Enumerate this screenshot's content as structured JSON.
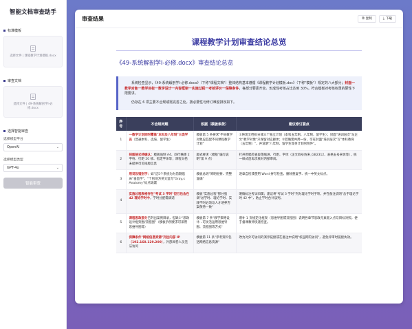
{
  "sidebar": {
    "app_title": "智能文档审查助手",
    "template_section": {
      "label": "标准模板",
      "file_name": "选择文件 | 课程教学计划模板.docx"
    },
    "review_doc_section": {
      "label": "审查文档",
      "file_name": "选择文件 | 49-系统解剖学I-必修.docx"
    },
    "smart_review_section": {
      "label": "选择智能审查",
      "platform_label": "选择模型平台",
      "platform_value": "OpenAI",
      "model_label": "选择模型类型",
      "model_value": "GPT-4o",
      "button_label": "智能审查"
    }
  },
  "panel": {
    "title": "审查结果",
    "copy_label": "复制",
    "download_label": "下载",
    "doc_title": "课程教学计划审查结论总览",
    "doc_subtitle": "《49-系统解剖学I-必修.docx》审查结论总览",
    "summary": {
      "part1": "系统检查显示，《49-系统解剖学I-必修.docx》（下称\"课程文档\"）整体结构基本遵循《课程教学计划模板.doc》（下称\"模板\"）规定的八大部分；",
      "highlight": "封面一教学对象一教学目标一教学设计一内容框架一实施过程一考核评价一保障条件",
      "part2": "，各部分要素齐全。形成性考核占比达到 30%，符合模板对考核权重的硬性下限要求。",
      "note": "仍存在 6 项主要不合规或需完善之处，按必要性与修订难度排序如下。"
    },
    "table": {
      "headers": [
        "序号",
        "不合规问题",
        "依据（模板条款）",
        "建议修订要点"
      ],
      "rows": [
        {
          "no": "1",
          "issue_red": "一教学计划同时覆盖\"本科及八年制\"三类学员",
          "issue_rest": "（普通本科、选培、留学生）",
          "basis": "模板第 5 条要求\"不同教学对象应匹配不同课程教学计划\"",
          "suggestion": "①将现文档拆分或三个独立计划（本科五年制、八年制、留学生）；封面\"培训层次\"与正文\"教学对象\"只保留对应群体；②若确需共用一份，可在封面\"培训层次\"写\"本科教育（五年制）\"，并说明\"八年制、留学生等另计划另附件\"。"
        },
        {
          "no": "2",
          "issue_red": "排版格式待确认：",
          "issue_rest": "模板强制 A4、四行横距 2 字符、行距 20 磅、指定字体等；课程文档未提供可见排版信息",
          "basis": "版式要求（模板\"编写说明\"第 9 点）",
          "suggestion": "打开原稿检查段落缩进、行距、字体（正文四号仿宋_GB2312、表格五号宋体等），统一样式后再次核对内部审阅。"
        },
        {
          "no": "3",
          "issue_red": "用词及错别字：",
          "issue_rest": "如\"这5个系统为为前期临床\"垂直学\"、\"个别地方英文监写\"Gray,s Anatomy\"标点缺漏",
          "basis": "模板总则\"简明扼要、完整准确\"",
          "suggestion": "逐章自检或使用 Word 拼写检查，删除重复字、统一中英文标点。"
        },
        {
          "no": "4",
          "issue_red": "实施过程表格存在\"考试 3 学时\"但已包含在 42 理论学时中",
          "issue_rest": "，学时分配需调适",
          "basis": "模板\"实施过程\"部分强调\"总学时、理论学时、实践学时必须与人才培养方案保持一致\"",
          "suggestion": "明确标注考试归属；建议将\"考试 3 学时\"列为理论学时子项，并在备注说明\"含于理论学时 42 中\"，防止学时合计误判。"
        },
        {
          "no": "5",
          "issue_red": "课程思政部分",
          "issue_rest": "已列出案例目录，但缺少\"思政设计框架图/流程图\"（模板示例要求可采用思维导图等）",
          "basis": "模板第 7 条\"教学策略设计…可灵活运用思维导图、流程图等方式\"",
          "suggestion": "增补 1 页规定化框架（思维导图或流程图）说明各章节思政元素嵌入点与目标对照，便于督课教师快速检查。"
        },
        {
          "no": "6",
          "issue_red": "保障条件\"网络信息资源\"列出内部 IP（192.168.129.200）",
          "issue_rest": "，外部阅卷人员无法访问",
          "basis": "模板第 11 条\"参考资料包括网络信息资源\"",
          "suggestion": "改为对外可访问的演示链接或在备注中说明\"校园网内访问\"，避免评审时链接失效。"
        }
      ]
    }
  }
}
